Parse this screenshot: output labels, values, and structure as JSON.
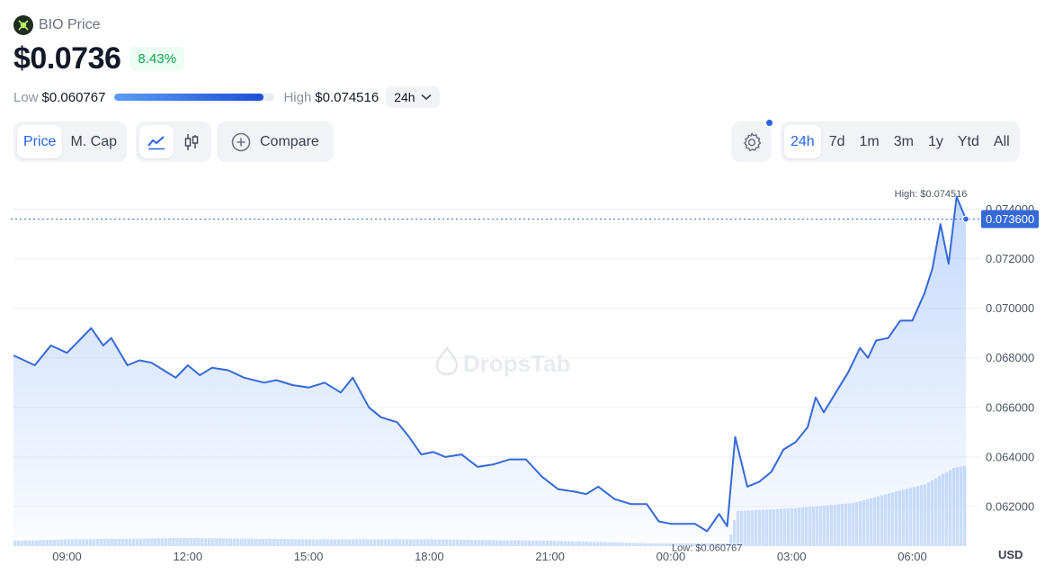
{
  "header": {
    "coin_name": "BIO Price",
    "price": "$0.0736",
    "change": "8.43%"
  },
  "range": {
    "low_label": "Low",
    "low_value": "$0.060767",
    "high_label": "High",
    "high_value": "$0.074516",
    "period": "24h",
    "position": 0.93
  },
  "toolbar": {
    "metric_tabs": [
      "Price",
      "M. Cap"
    ],
    "active_metric": "Price",
    "compare_label": "Compare",
    "periods": [
      "24h",
      "7d",
      "1m",
      "3m",
      "1y",
      "Ytd",
      "All"
    ],
    "active_period": "24h"
  },
  "colors": {
    "accent": "#2563eb",
    "line": "#3569d8",
    "positive": "#16a34a"
  },
  "chart_data": {
    "type": "line",
    "x_ticks": [
      "09:00",
      "12:00",
      "15:00",
      "18:00",
      "21:00",
      "00:00",
      "03:00",
      "06:00"
    ],
    "y_ticks": [
      "0.062000",
      "0.064000",
      "0.066000",
      "0.068000",
      "0.070000",
      "0.072000",
      "0.074000"
    ],
    "y_tick_values": [
      0.062,
      0.064,
      0.066,
      0.068,
      0.07,
      0.072,
      0.074
    ],
    "ylim": [
      0.0604,
      0.075
    ],
    "x_range_hours": [
      7.67,
      31.33
    ],
    "current_value": 0.0736,
    "current_label": "0.073600",
    "high_annotation": "High: $0.074516",
    "low_annotation": "Low: $0.060767",
    "watermark": "DropsTab",
    "currency_label": "USD",
    "series": [
      {
        "x": [
          7.67,
          8.2,
          8.6,
          9.0,
          9.3,
          9.6,
          9.9,
          10.1,
          10.5,
          10.8,
          11.1,
          11.4,
          11.7,
          12.0,
          12.3,
          12.6,
          13.0,
          13.4,
          13.9,
          14.2,
          14.6,
          15.0,
          15.4,
          15.8,
          16.1,
          16.5,
          16.8,
          17.2,
          17.5,
          17.8,
          18.1,
          18.4,
          18.8,
          19.2,
          19.6,
          20.0,
          20.4,
          20.8,
          21.2,
          21.6,
          21.9,
          22.2,
          22.6,
          23.0,
          23.4,
          23.7,
          24.0,
          24.3,
          24.6,
          24.9,
          25.2,
          25.4,
          25.6,
          25.9,
          26.2,
          26.5,
          26.8,
          27.1,
          27.4,
          27.6,
          27.8,
          28.1,
          28.4,
          28.7,
          28.9,
          29.1,
          29.4,
          29.7,
          30.0,
          30.3,
          30.5,
          30.7,
          30.9,
          31.1,
          31.33
        ],
        "y": [
          0.0681,
          0.0677,
          0.0685,
          0.0682,
          0.0687,
          0.0692,
          0.0685,
          0.0688,
          0.0677,
          0.0679,
          0.0678,
          0.0675,
          0.0672,
          0.0677,
          0.0673,
          0.0676,
          0.0675,
          0.0672,
          0.067,
          0.0671,
          0.0669,
          0.0668,
          0.067,
          0.0666,
          0.0672,
          0.066,
          0.0656,
          0.0654,
          0.0648,
          0.0641,
          0.0642,
          0.064,
          0.0641,
          0.0636,
          0.0637,
          0.0639,
          0.0639,
          0.0632,
          0.0627,
          0.0626,
          0.0625,
          0.0628,
          0.0623,
          0.0621,
          0.0621,
          0.0614,
          0.0613,
          0.0613,
          0.0613,
          0.061,
          0.0617,
          0.0612,
          0.0648,
          0.0628,
          0.063,
          0.0634,
          0.0643,
          0.0646,
          0.0652,
          0.0664,
          0.0658,
          0.0666,
          0.0674,
          0.0684,
          0.068,
          0.0687,
          0.0688,
          0.0695,
          0.0695,
          0.0706,
          0.0716,
          0.0734,
          0.0718,
          0.0745,
          0.0736
        ]
      }
    ],
    "volume": {
      "x": [
        7.67,
        9.0,
        12.0,
        15.0,
        18.0,
        21.0,
        23.5,
        25.4,
        25.6,
        27.0,
        28.5,
        29.5,
        30.3,
        30.7,
        31.0,
        31.33
      ],
      "y": [
        0.04,
        0.05,
        0.06,
        0.05,
        0.05,
        0.04,
        0.02,
        0.02,
        0.26,
        0.28,
        0.32,
        0.4,
        0.46,
        0.53,
        0.58,
        0.6
      ]
    }
  }
}
